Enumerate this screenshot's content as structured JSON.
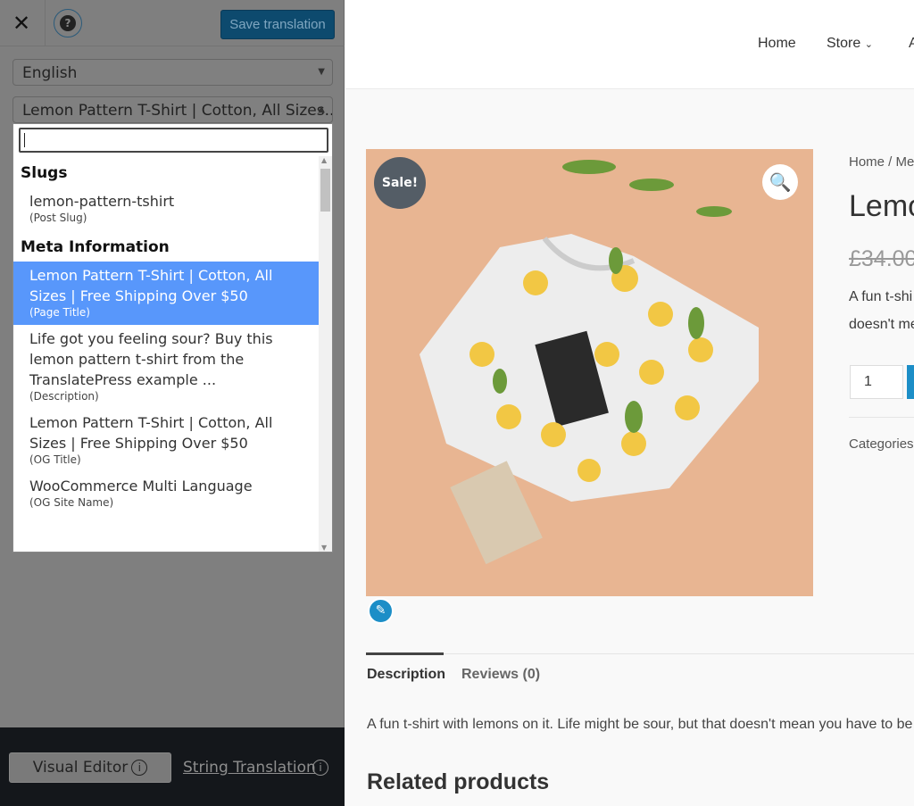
{
  "editor": {
    "close_icon": "close-icon",
    "help_icon": "question-icon",
    "save_label": "Save translation",
    "language": "English",
    "string_selected": "Lemon Pattern T-Shirt | Cotton, All Sizes...",
    "search_value": "",
    "groups": [
      {
        "label": "Slugs",
        "options": [
          {
            "text": "lemon-pattern-tshirt",
            "type": "(Post Slug)"
          }
        ]
      },
      {
        "label": "Meta Information",
        "options": [
          {
            "text": "Lemon Pattern T-Shirt | Cotton, All Sizes | Free Shipping Over $50",
            "type": "(Page Title)",
            "selected": true
          },
          {
            "text": "Life got you feeling sour? Buy this lemon pattern t-shirt from the TranslatePress example ...",
            "type": "(Description)"
          },
          {
            "text": "Lemon Pattern T-Shirt | Cotton, All Sizes | Free Shipping Over $50",
            "type": "(OG Title)"
          },
          {
            "text": "WooCommerce Multi Language",
            "type": "(OG Site Name)"
          }
        ]
      }
    ],
    "visual_editor_label": "Visual Editor",
    "string_translation_label": "String Translation",
    "info_glyph": "i",
    "accent": "#5897fb"
  },
  "site": {
    "nav": [
      "Home",
      "Store",
      "A"
    ],
    "breadcrumb": "Home / Me",
    "title": "Lemo",
    "old_price": "£34.00",
    "short_desc_1": "A fun t-shi",
    "short_desc_2": "doesn't me",
    "quantity": "1",
    "categories": "Categories",
    "sale_badge": "Sale!",
    "tabs": [
      "Description",
      "Reviews (0)"
    ],
    "description": "A fun t-shirt with lemons on it. Life might be sour, but that doesn't mean you have to be",
    "related": "Related products"
  }
}
